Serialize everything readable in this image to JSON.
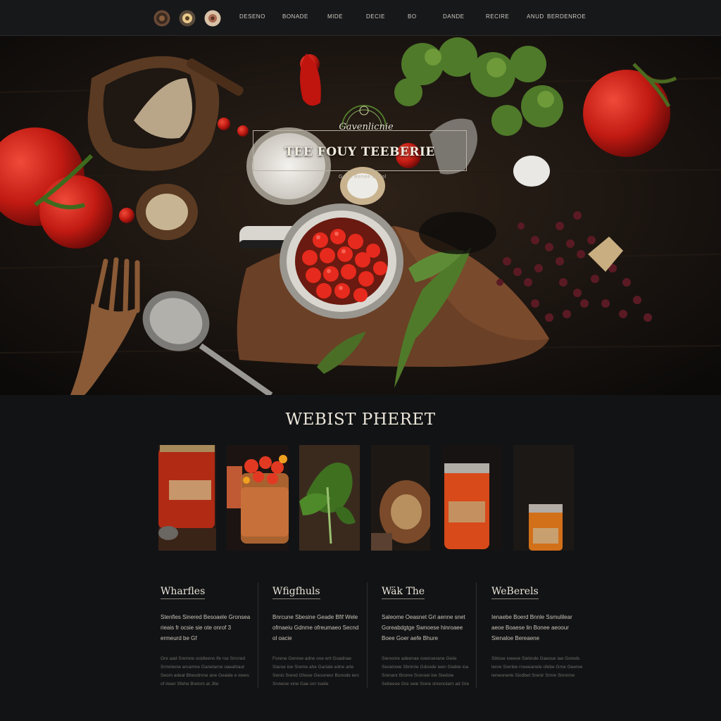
{
  "nav": {
    "icons": [
      "plate-icon",
      "sun-badge-icon",
      "flower-badge-icon"
    ],
    "links": [
      "Deseno",
      "Bonade",
      "Mide",
      "Decie",
      "Bo",
      "Dande",
      "Recire",
      "Anud",
      "Berdenroe"
    ]
  },
  "hero": {
    "brand": "Gavenlicnie",
    "title": "TEE FOUY TEEBERIE",
    "subtitle": "Goen Benee Grfiol"
  },
  "section": {
    "title": "WEBIST PHERET"
  },
  "gallery": [
    {
      "label": "Tomato sauce jar"
    },
    {
      "label": "Cherry tomatoes in jar"
    },
    {
      "label": "Fresh greens"
    },
    {
      "label": "Pasta on board"
    },
    {
      "label": "Pepper sauce jar"
    },
    {
      "label": "Small sauce jar"
    }
  ],
  "columns": [
    {
      "heading": "Wharfles",
      "lead": "Stenfies Sinered Besoaele Gronsea rieais fr ocsie sie ote onrof 3 ermeurd be Gf",
      "body": "Gre aad Sremne ocidleens ife rse Srrcred Srmnlenw arcamne Ganetarne oaeahiaut Seom adeal Bbesdnme ane Geaide e ioees of ineer Sfehe Brelom at Jtte"
    },
    {
      "heading": "Wfigfhuls",
      "lead": "Bnrcune Sbesine Geade Bfif Wele ofmaeiu Gdnme ofreumaeo Secnd ol oacie",
      "body": "Forene Genree adne ooe wrt Goadnae Siaroe ioe Sreme ahe Gariate edne arte Senio Srend Ghese Gesonesr Bonode ierc Srvteow vine Gae iorr tseile"
    },
    {
      "heading": "Wäk The",
      "lead": "Saleome Oeasnet Grl aenne snet Goreabdgtge Swnoese hinroaee Boee Goer aefe Bhure",
      "body": "Sienonre adeenae ooenoerane Geiie Seoeinwe Sbrinrie Gdoode ieen Giabte ioa Srenanr Brome Sronoei ine Siedoie Sebeeoe Gre seie Srere shrenolarn ad Gre"
    },
    {
      "heading": "WeBerels",
      "lead": "Ienaebe Boerd Bnnle Ssmulilear aeoe Boaese lin Bonee aeoour Sienaloe Bereaene",
      "body": "Sbtsse ioeeoe Siebnde Gaeoue iae Goreds lenre Srenbe rnoeeanele ofebe Grne Geeree ienwonerle Siodbet Srenir Srnre Sinnrme"
    }
  ]
}
